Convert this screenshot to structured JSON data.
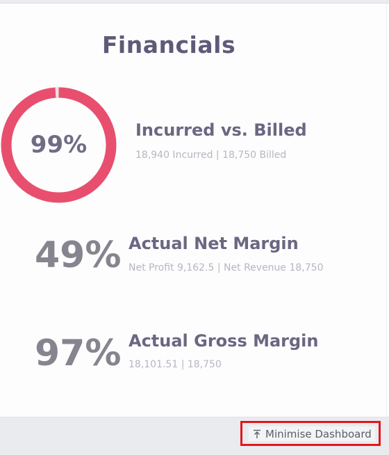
{
  "financials": {
    "title": "Financials",
    "incurred_vs_billed": {
      "percent_label": "99%",
      "percent_value": 99,
      "ring_color": "#e84f6e",
      "title": "Incurred vs. Billed",
      "subtitle": "18,940 Incurred | 18,750 Billed"
    },
    "net_margin": {
      "percent_label": "49%",
      "title": "Actual Net Margin",
      "subtitle": "Net Profit 9,162.5 | Net Revenue 18,750"
    },
    "gross_margin": {
      "percent_label": "97%",
      "title": "Actual Gross Margin",
      "subtitle": "18,101.51 | 18,750"
    }
  },
  "footer": {
    "minimise_label": "Minimise Dashboard",
    "minimise_icon": "arrow-up-to-line-icon",
    "highlight_color": "#e3161d"
  }
}
